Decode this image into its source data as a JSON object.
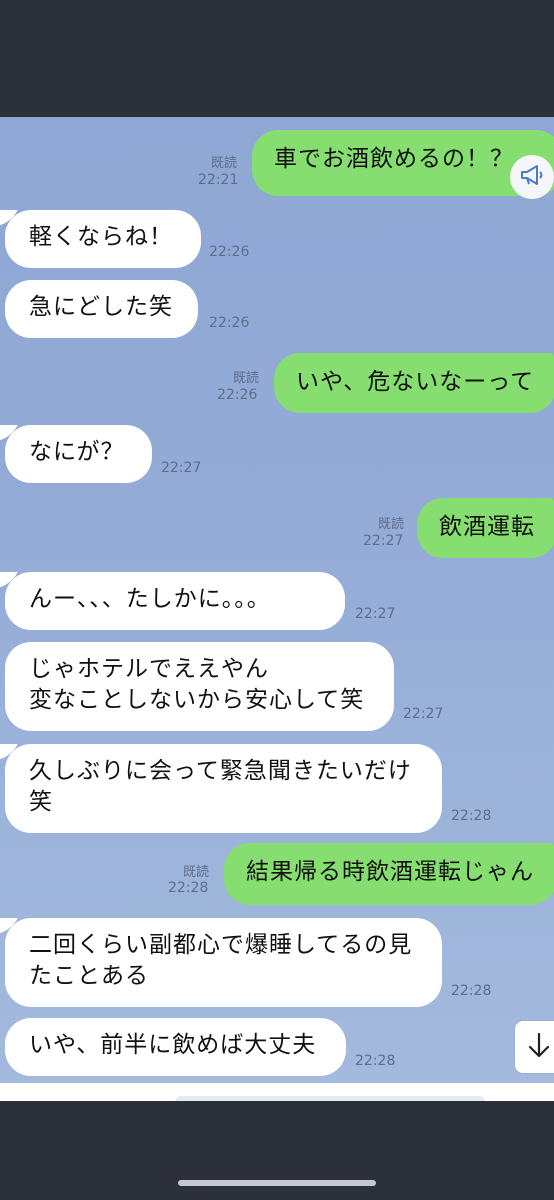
{
  "messages": [
    {
      "side": "out",
      "text": "車でお酒飲めるの！？",
      "read": "既読",
      "time": "22:21"
    },
    {
      "side": "in",
      "text": "軽くならね！",
      "time": "22:26"
    },
    {
      "side": "in",
      "text": "急にどした笑",
      "time": "22:26"
    },
    {
      "side": "out",
      "text": "いや、危ないなーって",
      "read": "既読",
      "time": "22:26"
    },
    {
      "side": "in",
      "text": "なにが？",
      "time": "22:27"
    },
    {
      "side": "out",
      "text": "飲酒運転",
      "read": "既読",
      "time": "22:27"
    },
    {
      "side": "in",
      "text": "んー、、、たしかに。。。",
      "time": "22:27"
    },
    {
      "side": "in",
      "text": "じゃホテルでええやん\n変なことしないから安心して笑",
      "time": "22:27"
    },
    {
      "side": "in",
      "text": "久しぶりに会って緊急聞きたいだけ\n笑",
      "time": "22:28"
    },
    {
      "side": "out",
      "text": "結果帰る時飲酒運転じゃん",
      "read": "既読",
      "time": "22:28"
    },
    {
      "side": "in",
      "text": "二回くらい副都心で爆睡してるの見\nたことある",
      "time": "22:28"
    },
    {
      "side": "in",
      "text": "いや、前半に飲めば大丈夫",
      "time": "22:28"
    }
  ],
  "icons": {
    "announce": "megaphone-icon",
    "scroll": "arrow-down-icon"
  },
  "colors": {
    "out_bubble": "#86de70",
    "in_bubble": "#ffffff",
    "background": "#93abd6",
    "bars": "#2b303b"
  }
}
